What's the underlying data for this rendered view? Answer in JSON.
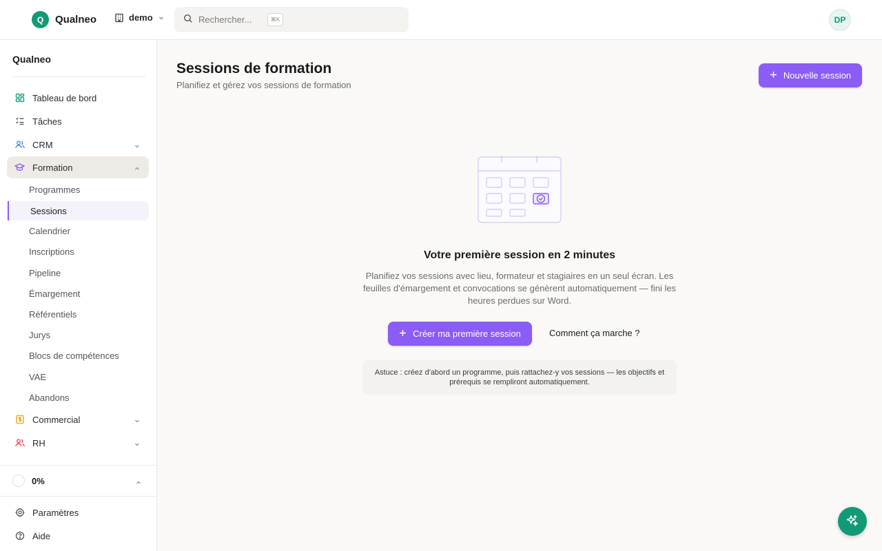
{
  "brand": {
    "logo_letter": "Q",
    "name": "Qualneo"
  },
  "workspace": {
    "name": "demo"
  },
  "search": {
    "placeholder": "Rechercher...",
    "shortcut": "⌘K"
  },
  "user": {
    "initials": "DP"
  },
  "sidebar": {
    "title": "Qualneo",
    "items": [
      {
        "label": "Tableau de bord",
        "icon": "dashboard-icon"
      },
      {
        "label": "Tâches",
        "icon": "list-check-icon"
      },
      {
        "label": "CRM",
        "icon": "users-icon",
        "expandable": true
      },
      {
        "label": "Formation",
        "icon": "graduation-cap-icon",
        "expanded": true,
        "active": true
      },
      {
        "label": "Commercial",
        "icon": "dollar-doc-icon",
        "expandable": true
      },
      {
        "label": "RH",
        "icon": "people-icon",
        "expandable": true
      }
    ],
    "formation_sub": [
      "Programmes",
      "Sessions",
      "Calendrier",
      "Inscriptions",
      "Pipeline",
      "Émargement",
      "Référentiels",
      "Jurys",
      "Blocs de compétences",
      "VAE",
      "Abandons"
    ],
    "active_sub": "Sessions",
    "progress": {
      "value": "0%",
      "fraction": 0
    },
    "footer": [
      {
        "label": "Paramètres",
        "icon": "gear-icon"
      },
      {
        "label": "Aide",
        "icon": "help-circle-icon"
      }
    ]
  },
  "page": {
    "title": "Sessions de formation",
    "subtitle": "Planifiez et gérez vos sessions de formation",
    "new_button": "Nouvelle session"
  },
  "empty_state": {
    "title": "Votre première session en 2 minutes",
    "description": "Planifiez vos sessions avec lieu, formateur et stagiaires en un seul écran. Les feuilles d'émargement et convocations se génèrent automatiquement — fini les heures perdues sur Word.",
    "create_button": "Créer ma première session",
    "help_link": "Comment ça marche ?",
    "tip": "Astuce : créez d'abord un programme, puis rattachez-y vos sessions — les objectifs et prérequis se rempliront automatiquement."
  },
  "colors": {
    "accent": "#8b5cf6",
    "brand": "#129a77",
    "background": "#faf9f7"
  }
}
